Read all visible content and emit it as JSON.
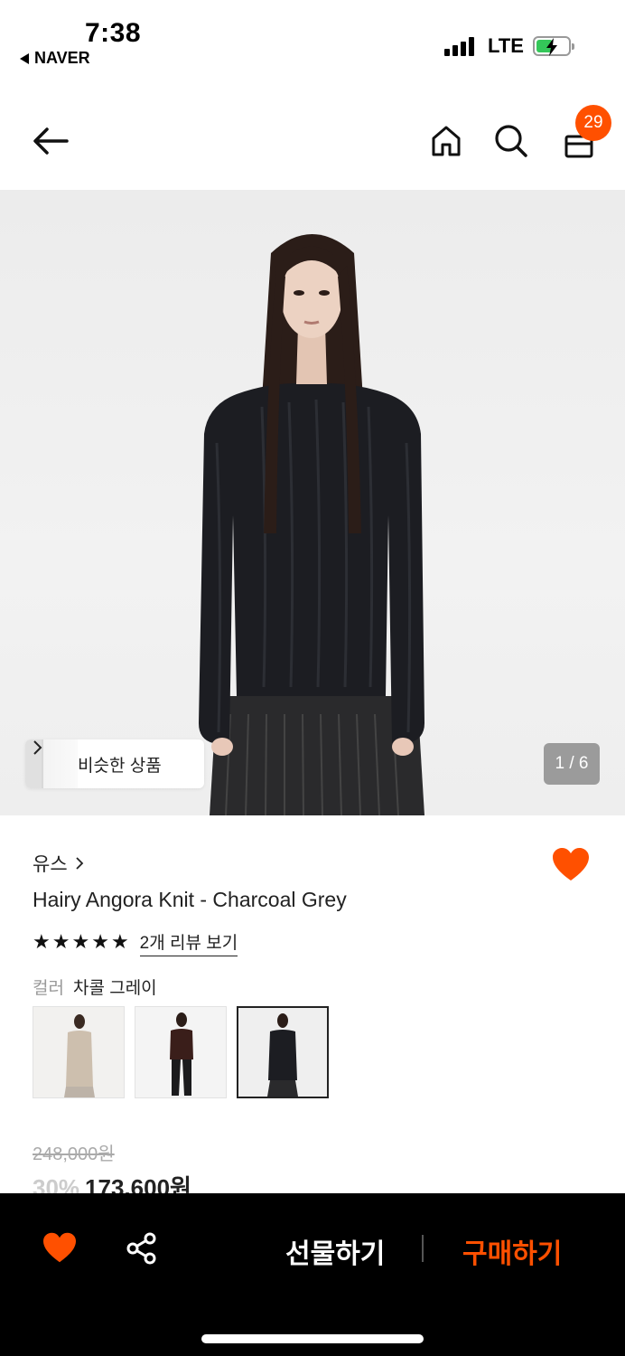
{
  "status_bar": {
    "time": "7:38",
    "back_app": "NAVER",
    "network": "LTE",
    "battery_icon": "battery-charging-icon"
  },
  "header": {
    "back_icon": "arrow-left-icon",
    "home_icon": "home-icon",
    "search_icon": "search-icon",
    "cart_icon": "shopping-bag-icon",
    "cart_count": "29"
  },
  "hero": {
    "similar_products_label": "비슷한 상품",
    "page_indicator": "1 / 6"
  },
  "product": {
    "brand": "유스",
    "name": "Hairy Angora Knit - Charcoal Grey",
    "rating_stars": 5,
    "review_link": "2개 리뷰 보기",
    "color_label": "컬러",
    "color_value": "차콜 그레이",
    "swatch_count": 3,
    "selected_swatch": 3,
    "original_price": "248,000원",
    "discount": "30%",
    "sale_price": "173,600원"
  },
  "bottom_bar": {
    "gift_label": "선물하기",
    "buy_label": "구매하기"
  },
  "colors": {
    "accent": "#ff5000",
    "bottom_bar_bg": "#000000"
  }
}
